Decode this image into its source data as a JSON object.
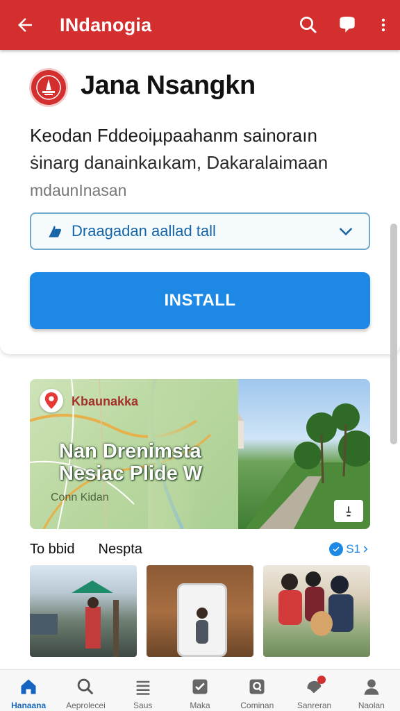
{
  "appbar": {
    "title": "INdanogia",
    "back_icon": "arrow-left-icon",
    "actions": [
      "search-icon",
      "chat-bubble-icon",
      "more-vert-icon"
    ],
    "color": "#d32f2f"
  },
  "app": {
    "name": "Jana Nsangkn",
    "logo_icon": "red-seal-logo",
    "description": {
      "line1": "Keodan Fddeoiµpaahanm sainoraın",
      "line2": "ṡinarg danainkaıkam, Dakaralaimaan",
      "line3": "mdaunInasan"
    },
    "dropdown_label": "Draagadan  aallad  tall",
    "install_label": "INSTALL",
    "accent": "#1e88e5"
  },
  "banner": {
    "place_label": "Kbaunakka",
    "headline_line1": "Nan Drenimsta",
    "headline_line2": "Nesiac Plide W",
    "map_label": "Conn Kidan",
    "corner_icon": "info-icon"
  },
  "section": {
    "title1": "To bbid",
    "title2": "Nespta",
    "more_label": "S1"
  },
  "thumbnails": [
    {
      "name": "street-market-photo"
    },
    {
      "name": "phone-portrait-photo"
    },
    {
      "name": "people-with-dog-photo"
    }
  ],
  "bottom_nav": {
    "items": [
      {
        "label": "Hanaana",
        "icon": "home-icon",
        "active": true
      },
      {
        "label": "Aeprolecei",
        "icon": "search-icon",
        "active": false
      },
      {
        "label": "Saus",
        "icon": "list-icon",
        "active": false
      },
      {
        "label": "Maka",
        "icon": "check-square-icon",
        "active": false
      },
      {
        "label": "Cominan",
        "icon": "chat-square-icon",
        "active": false
      },
      {
        "label": "Sanreran",
        "icon": "notification-icon",
        "active": false,
        "badge": true
      },
      {
        "label": "Naolan",
        "icon": "person-icon",
        "active": false
      }
    ]
  }
}
